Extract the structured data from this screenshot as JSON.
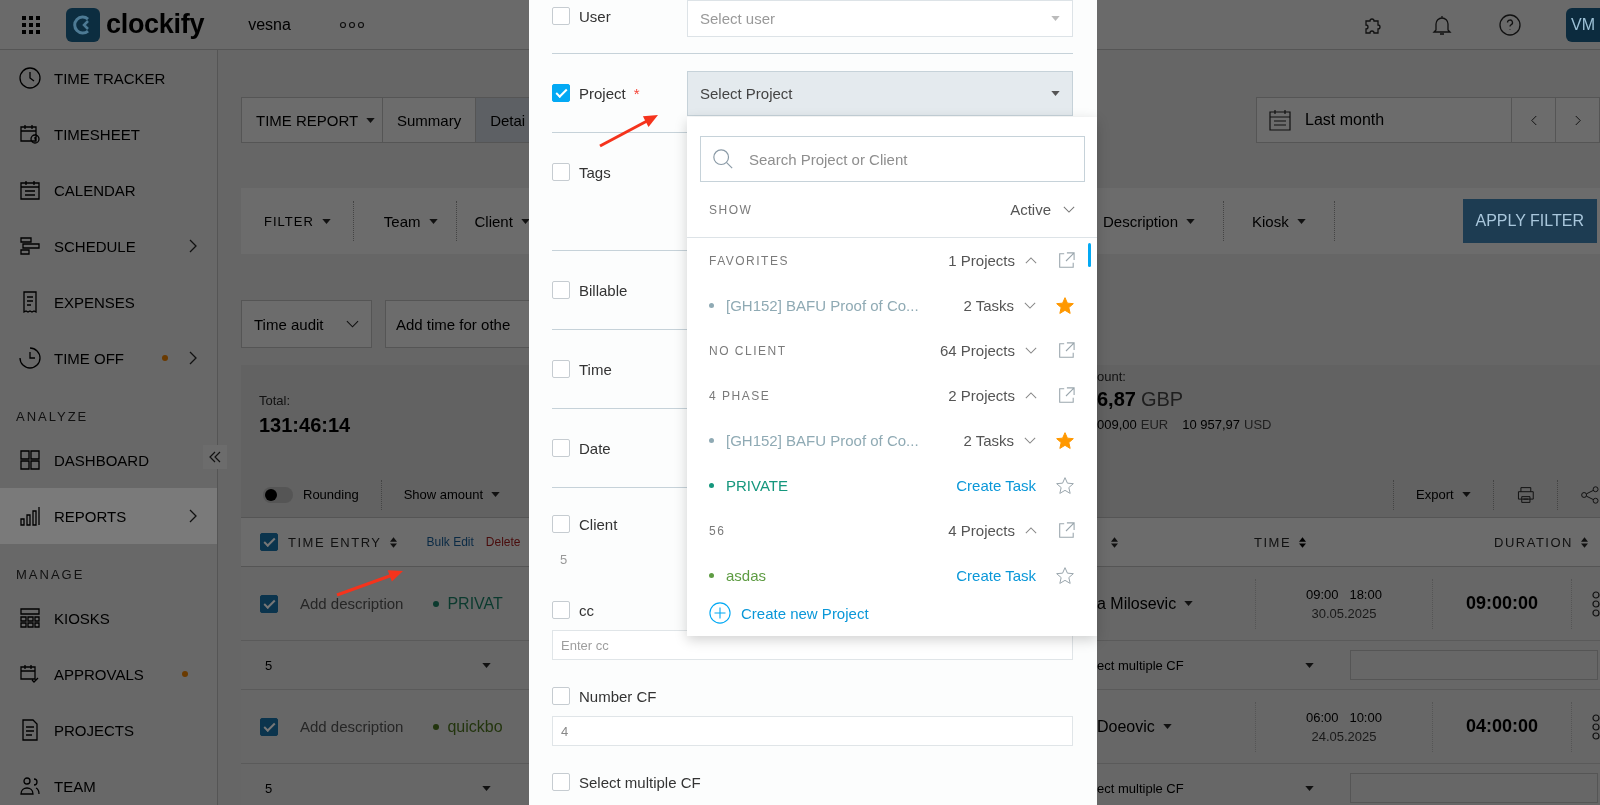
{
  "topbar": {
    "brand": "clockify",
    "workspace": "vesna",
    "avatar": "VM"
  },
  "sidebar": [
    {
      "kind": "item",
      "label": "TIME TRACKER",
      "selected": false,
      "dot": false,
      "submenu": false
    },
    {
      "kind": "item",
      "label": "TIMESHEET",
      "selected": false,
      "dot": false,
      "submenu": false
    },
    {
      "kind": "item",
      "label": "CALENDAR",
      "selected": false,
      "dot": false,
      "submenu": false
    },
    {
      "kind": "item",
      "label": "SCHEDULE",
      "selected": false,
      "dot": false,
      "submenu": true
    },
    {
      "kind": "item",
      "label": "EXPENSES",
      "selected": false,
      "dot": false,
      "submenu": false
    },
    {
      "kind": "item",
      "label": "TIME OFF",
      "selected": false,
      "dot": true,
      "submenu": true
    },
    {
      "kind": "heading",
      "label": "ANALYZE"
    },
    {
      "kind": "item",
      "label": "DASHBOARD",
      "selected": false,
      "dot": false,
      "submenu": false
    },
    {
      "kind": "item",
      "label": "REPORTS",
      "selected": true,
      "dot": false,
      "submenu": true
    },
    {
      "kind": "heading",
      "label": "MANAGE"
    },
    {
      "kind": "item",
      "label": "KIOSKS",
      "selected": false,
      "dot": false,
      "submenu": false
    },
    {
      "kind": "item",
      "label": "APPROVALS",
      "selected": false,
      "dot": true,
      "submenu": false
    },
    {
      "kind": "item",
      "label": "PROJECTS",
      "selected": false,
      "dot": false,
      "submenu": false
    },
    {
      "kind": "item",
      "label": "TEAM",
      "selected": false,
      "dot": false,
      "submenu": false
    }
  ],
  "report_tabs": [
    {
      "label": "TIME REPORT",
      "dropdown": true,
      "selected": false
    },
    {
      "label": "Summary",
      "dropdown": false,
      "selected": false
    },
    {
      "label": "Detai",
      "dropdown": false,
      "selected": true
    }
  ],
  "date_range": {
    "label": "Last month"
  },
  "filters": {
    "left": [
      {
        "label": "FILTER",
        "kind": "main"
      },
      {
        "label": "Team",
        "kind": "field"
      },
      {
        "label": "Client",
        "kind": "field"
      }
    ],
    "right": [
      {
        "label": "Description"
      },
      {
        "label": "Kiosk"
      }
    ],
    "apply": "APPLY FILTER"
  },
  "time_audit": "Time audit",
  "add_time": "Add time for othe",
  "totals": {
    "total_label": "Total:",
    "total": "131:46:14",
    "amount_label": "ount:",
    "amount": "6,87",
    "amount_currency": "GBP",
    "other": [
      {
        "value": "009,00",
        "currency": "EUR"
      },
      {
        "value": "10 957,97",
        "currency": "USD"
      }
    ]
  },
  "toolbar": {
    "rounding": {
      "label": "Rounding",
      "on": false
    },
    "show_amount": "Show amount",
    "export": "Export"
  },
  "table": {
    "select_all": true,
    "time_entry": "TIME ENTRY",
    "bulk_edit": "Bulk Edit",
    "delete": "Delete",
    "time": "TIME",
    "duration": "DURATION",
    "rows": [
      {
        "checked": true,
        "description_placeholder": "Add description",
        "project": "PRIVAT",
        "color": "#0b3a2e",
        "user": "a Milosevic",
        "start": "09:00",
        "end": "18:00",
        "date": "30.05.2025",
        "duration": "09:00:00",
        "cf_value": "5",
        "cf_select": "ect multiple CF"
      },
      {
        "checked": true,
        "description_placeholder": "Add description",
        "project": "quickbo",
        "color": "#23350e",
        "user": "Doeovic",
        "start": "06:00",
        "end": "10:00",
        "date": "24.05.2025",
        "duration": "04:00:00",
        "cf_value": "5",
        "cf_select": "ect multiple CF"
      }
    ]
  },
  "modal": {
    "fields": [
      {
        "kind": "select",
        "label": "User",
        "checked": false,
        "placeholder": "Select user",
        "open": false
      },
      {
        "kind": "select",
        "label": "Project",
        "checked": true,
        "required_mark": "*",
        "placeholder": "Select Project",
        "open": true
      },
      {
        "kind": "basic",
        "label": "Tags",
        "checked": false
      },
      {
        "kind": "basic",
        "label": "Billable",
        "checked": false
      },
      {
        "kind": "basic",
        "label": "Time",
        "checked": false
      },
      {
        "kind": "basic",
        "label": "Date",
        "checked": false
      },
      {
        "kind": "custom",
        "label": "Client",
        "checked": false,
        "input": {
          "kind": "plain",
          "value": "5"
        }
      },
      {
        "kind": "custom",
        "label": "cc",
        "checked": false,
        "input": {
          "kind": "box",
          "placeholder": "Enter cc"
        }
      },
      {
        "kind": "custom",
        "label": "Number CF",
        "checked": false,
        "input": {
          "kind": "box",
          "value": "4"
        }
      },
      {
        "kind": "custom",
        "label": "Select multiple CF",
        "checked": false
      }
    ]
  },
  "project_dropdown": {
    "search_placeholder": "Search Project or Client",
    "show_label": "SHOW",
    "show_value": "Active",
    "items": [
      {
        "kind": "group",
        "label": "FAVORITES",
        "count": "1 Projects",
        "expanded": true
      },
      {
        "kind": "project",
        "name": "[GH152] BAFU Proof of Co...",
        "color": "#8faab4",
        "tasks": "2 Tasks",
        "starred": true
      },
      {
        "kind": "group",
        "label": "NO CLIENT",
        "count": "64 Projects",
        "expanded": false
      },
      {
        "kind": "group",
        "label": "4 PHASE",
        "count": "2 Projects",
        "expanded": true
      },
      {
        "kind": "project",
        "name": "[GH152] BAFU Proof of Co...",
        "color": "#8faab4",
        "tasks": "2 Tasks",
        "starred": true
      },
      {
        "kind": "project",
        "name": "PRIVATE",
        "color": "#15977d",
        "create_task": "Create Task",
        "starred": false
      },
      {
        "kind": "group",
        "label": "56",
        "count": "4 Projects",
        "expanded": true
      },
      {
        "kind": "project",
        "name": "asdas",
        "color": "#5e9c43",
        "create_task": "Create Task",
        "starred": false
      }
    ],
    "create": "Create new Project"
  }
}
